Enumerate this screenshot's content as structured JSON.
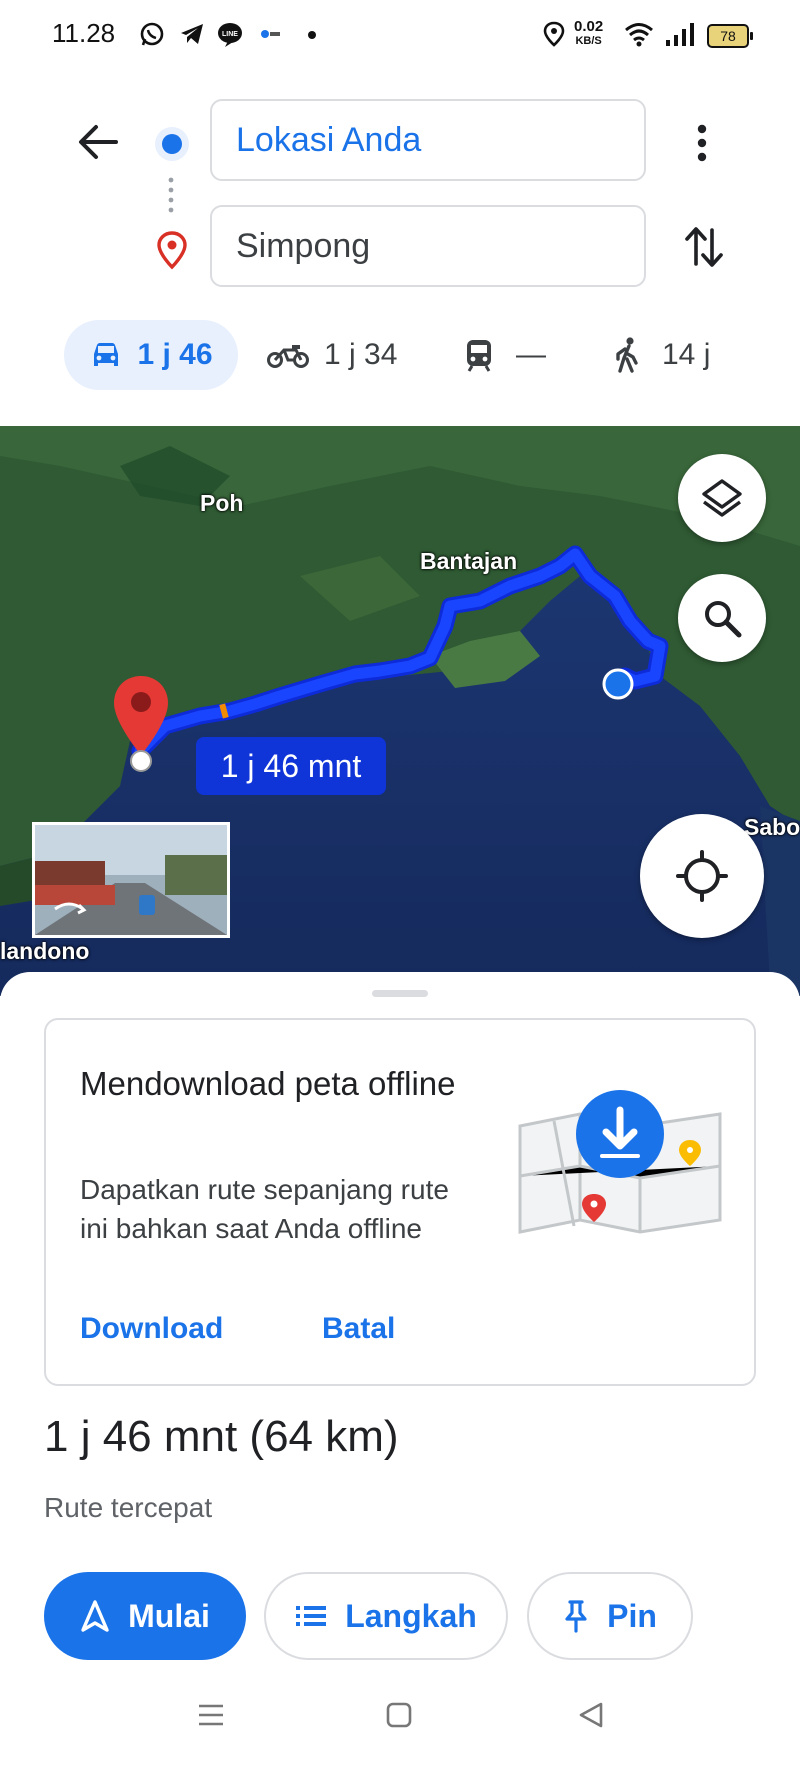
{
  "status_bar": {
    "time": "11.28",
    "data_speed_value": "0.02",
    "data_speed_unit": "KB/S",
    "battery": "78",
    "icons": [
      "whatsapp-icon",
      "telegram-icon",
      "line-icon",
      "app-icon",
      "dot-icon",
      "location-icon",
      "wifi-icon",
      "signal-icon",
      "battery-icon"
    ]
  },
  "directions": {
    "origin": "Lokasi Anda",
    "destination": "Simpong"
  },
  "modes": [
    {
      "name": "car",
      "label": "1 j 46",
      "selected": true
    },
    {
      "name": "motorcycle",
      "label": "1 j 34",
      "selected": false
    },
    {
      "name": "transit",
      "label": "—",
      "selected": false
    },
    {
      "name": "walk",
      "label": "14 j",
      "selected": false
    }
  ],
  "map": {
    "places": [
      "Poh",
      "Bantajan",
      "Sabo",
      "landono"
    ],
    "route_label": "1 j 46 mnt",
    "colors": {
      "route": "#1a45ff",
      "route_label_bg": "#0f34d8",
      "pin": "#e53935"
    }
  },
  "offline_card": {
    "title": "Mendownload peta offline",
    "body": "Dapatkan rute sepanjang rute ini bahkan saat Anda offline",
    "download_label": "Download",
    "cancel_label": "Batal"
  },
  "route_summary": {
    "time_distance": "1 j 46 mnt (64 km)",
    "description": "Rute tercepat"
  },
  "actions": {
    "start": "Mulai",
    "steps": "Langkah",
    "pin": "Pin"
  },
  "colors": {
    "accent": "#1a73e8",
    "selected_mode_bg": "#e8f0fe"
  }
}
